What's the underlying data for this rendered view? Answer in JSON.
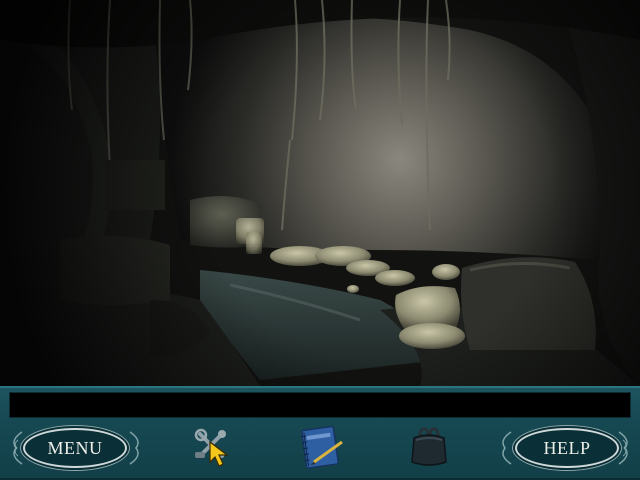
{
  "dialog": {
    "text": ""
  },
  "hud": {
    "menu_label": "MENU",
    "help_label": "HELP",
    "icons": [
      "tools-icon",
      "journal-icon",
      "purse-icon",
      "arrow-cursor-icon"
    ]
  },
  "colors": {
    "hud_teal": "#174a54",
    "button_fill": "#0a2f36",
    "button_border": "#cfd9d9"
  }
}
